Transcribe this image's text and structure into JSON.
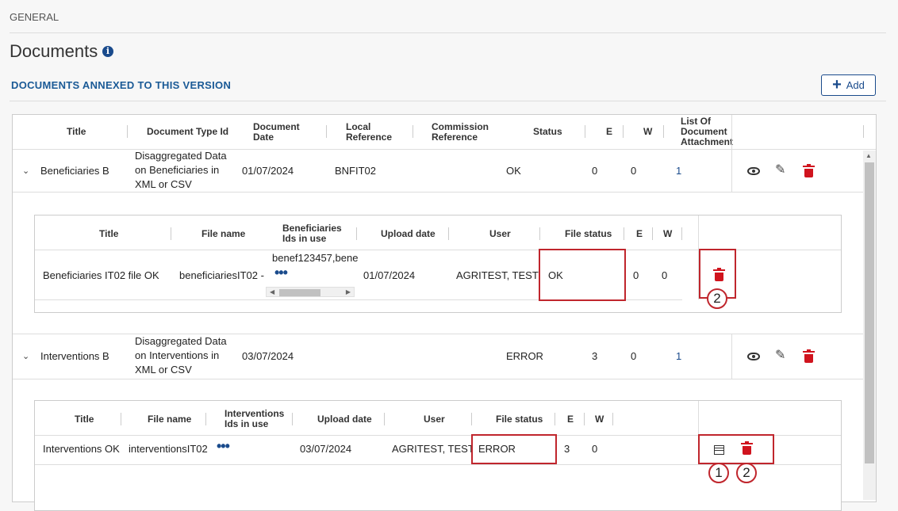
{
  "breadcrumb": "GENERAL",
  "page_title": "Documents",
  "info_glyph": "i",
  "section_title": "DOCUMENTS ANNEXED TO THIS VERSION",
  "add_label": "Add",
  "main_headers": {
    "title": "Title",
    "doc_type": "Document Type Id",
    "doc_date": "Document\nDate",
    "local_ref": "Local\nReference",
    "comm_ref": "Commission\nReference",
    "status": "Status",
    "e": "E",
    "w": "W",
    "list": "List Of\nDocument\nAttachment"
  },
  "rows": [
    {
      "title": "Beneficiaries B",
      "doc_type": "Disaggregated Data\non Beneficiaries in\nXML or CSV",
      "doc_date": "01/07/2024",
      "local_ref": "BNFIT02",
      "status": "OK",
      "e": "0",
      "w": "0",
      "list": "1",
      "sub": {
        "headers": {
          "title": "Title",
          "file_name": "File name",
          "ids": "Beneficiaries\nIds in use",
          "upload": "Upload date",
          "user": "User",
          "file_status": "File status",
          "e": "E",
          "w": "W"
        },
        "title": "Beneficiaries IT02 file OK",
        "file_name": "beneficiariesIT02 -",
        "ids": "benef123457,bene",
        "upload": "01/07/2024",
        "user": "AGRITEST, TEST",
        "file_status": "OK",
        "e": "0",
        "w": "0"
      }
    },
    {
      "title": "Interventions B",
      "doc_type": "Disaggregated Data\non Interventions in\nXML or CSV",
      "doc_date": "03/07/2024",
      "local_ref": "",
      "status": "ERROR",
      "e": "3",
      "w": "0",
      "list": "1",
      "sub": {
        "headers": {
          "title": "Title",
          "file_name": "File name",
          "ids": "Interventions\nIds in use",
          "upload": "Upload date",
          "user": "User",
          "file_status": "File status",
          "e": "E",
          "w": "W"
        },
        "title": "Interventions OK",
        "file_name": "interventionsIT02",
        "upload": "03/07/2024",
        "user": "AGRITEST, TEST",
        "file_status": "ERROR",
        "e": "3",
        "w": "0"
      }
    }
  ],
  "ellipsis": "•••",
  "callouts": {
    "one": "1",
    "two": "2"
  },
  "colors": {
    "accent": "#1a4b8c",
    "danger": "#d0141e",
    "highlight": "#c0262d"
  }
}
